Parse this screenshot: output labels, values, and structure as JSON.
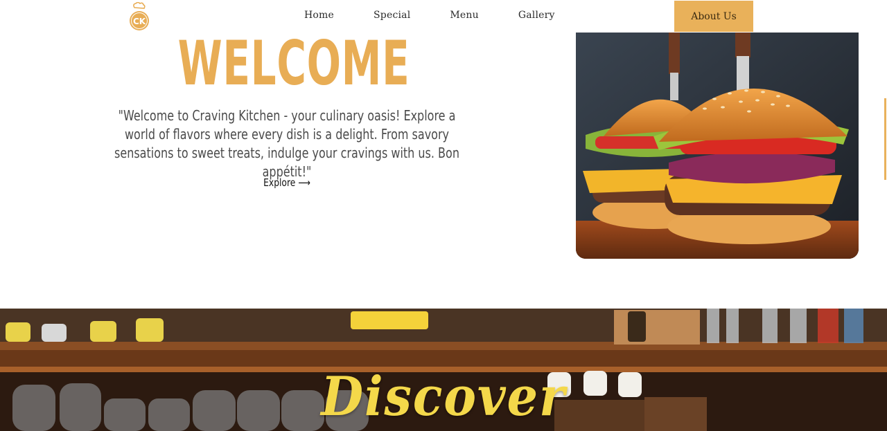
{
  "brand": {
    "logo_text": "CK"
  },
  "nav": {
    "links": [
      {
        "label": "Home"
      },
      {
        "label": "Special"
      },
      {
        "label": "Menu"
      },
      {
        "label": "Gallery"
      }
    ],
    "cta_label": "About Us"
  },
  "hero": {
    "title": "WELCOME",
    "description": "\"Welcome to Craving Kitchen - your culinary oasis! Explore a world of flavors where every dish is a delight. From savory sensations to sweet treats, indulge your cravings with us. Bon appétit!\"",
    "explore_label": "Explore ⟶"
  },
  "banner": {
    "title": "Discover"
  },
  "colors": {
    "accent": "#e9b15a",
    "title": "#e8ad55",
    "banner_title": "#f4d84a"
  }
}
